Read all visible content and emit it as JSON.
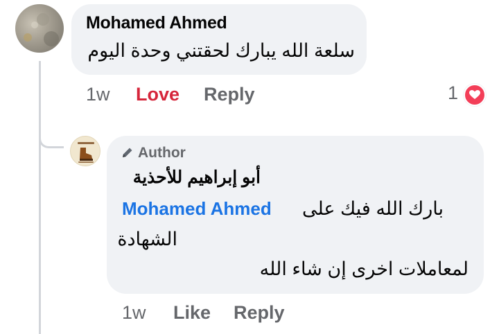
{
  "comment": {
    "author": "Mohamed Ahmed",
    "text": "سلعة الله يبارك لحقتني وحدة اليوم",
    "time": "1w",
    "reaction_label": "Love",
    "reply_label": "Reply",
    "reaction_count": "1",
    "reaction_icon": "heart-icon",
    "reaction_color": "#f33e58"
  },
  "reply": {
    "badge": "Author",
    "badge_icon": "pencil-icon",
    "author": "أبو إبراهيم للأحذية",
    "mention": "Mohamed Ahmed",
    "line1": "بارك الله فيك على",
    "line2": "الشهادة",
    "line3": "لمعاملات اخرى إن شاء الله",
    "time": "1w",
    "like_label": "Like",
    "reply_label": "Reply"
  },
  "colors": {
    "love": "#d6263b",
    "mention": "#1b74e4",
    "meta": "#65676b",
    "bubble": "#f0f2f5"
  }
}
